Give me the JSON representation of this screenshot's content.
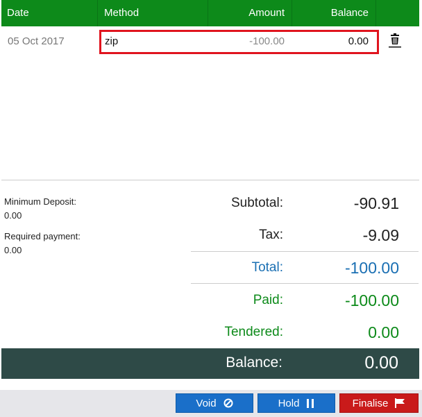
{
  "table": {
    "headers": {
      "date": "Date",
      "method": "Method",
      "amount": "Amount",
      "balance": "Balance"
    },
    "rows": [
      {
        "date": "05 Oct 2017",
        "method": "zip",
        "amount": "-100.00",
        "balance": "0.00"
      }
    ]
  },
  "deposit": {
    "minimum_label": "Minimum Deposit:",
    "minimum_value": "0.00",
    "required_label": "Required payment:",
    "required_value": "0.00"
  },
  "totals": {
    "subtotal_label": "Subtotal:",
    "subtotal_value": "-90.91",
    "tax_label": "Tax:",
    "tax_value": "-9.09",
    "total_label": "Total:",
    "total_value": "-100.00",
    "paid_label": "Paid:",
    "paid_value": "-100.00",
    "tendered_label": "Tendered:",
    "tendered_value": "0.00",
    "balance_label": "Balance:",
    "balance_value": "0.00"
  },
  "actions": {
    "void_label": "Void",
    "hold_label": "Hold",
    "finalise_label": "Finalise"
  },
  "icons": {
    "trash": "trash-icon",
    "void": "cancel-icon",
    "hold": "pause-icon",
    "finalise": "flag-icon"
  },
  "colors": {
    "header_green": "#0d8a1a",
    "highlight_red": "#e0141e",
    "total_blue": "#1a6fb3",
    "paid_green": "#0d8a1a",
    "balance_bar": "#2e4a47",
    "button_blue": "#1a6fc9",
    "button_red": "#c91a1a"
  }
}
